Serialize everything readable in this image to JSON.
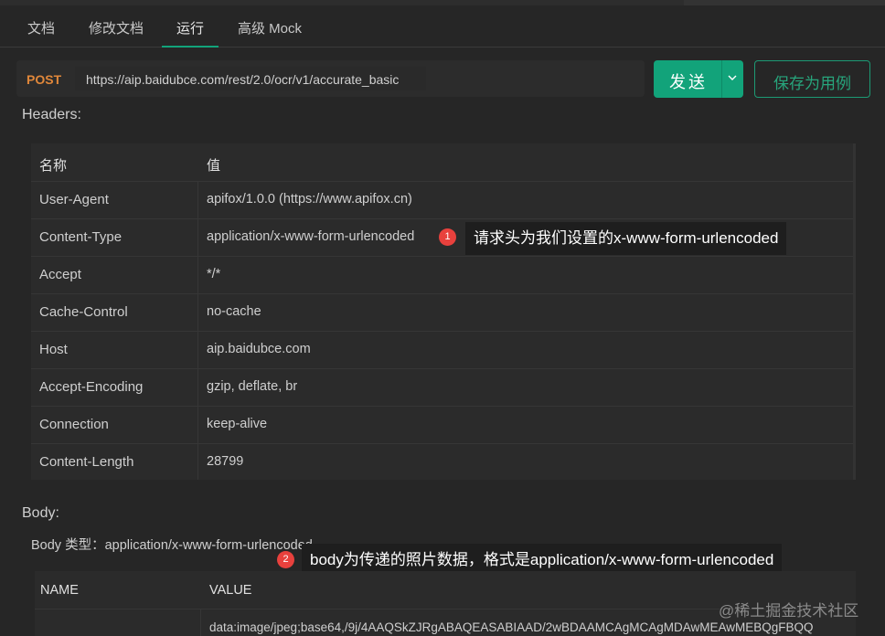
{
  "tabs": [
    {
      "label": "文档"
    },
    {
      "label": "修改文档"
    },
    {
      "label": "运行"
    },
    {
      "label": "高级 Mock"
    }
  ],
  "request": {
    "method": "POST",
    "url": "https://aip.baidubce.com/rest/2.0/ocr/v1/accurate_basic",
    "send_label": "发送",
    "save_label": "保存为用例"
  },
  "headers": {
    "title": "Headers:",
    "col_name": "名称",
    "col_value": "值",
    "rows": [
      {
        "name": "User-Agent",
        "value": "apifox/1.0.0 (https://www.apifox.cn)"
      },
      {
        "name": "Content-Type",
        "value": "application/x-www-form-urlencoded"
      },
      {
        "name": "Accept",
        "value": "*/*"
      },
      {
        "name": "Cache-Control",
        "value": "no-cache"
      },
      {
        "name": "Host",
        "value": "aip.baidubce.com"
      },
      {
        "name": "Accept-Encoding",
        "value": "gzip, deflate, br"
      },
      {
        "name": "Connection",
        "value": "keep-alive"
      },
      {
        "name": "Content-Length",
        "value": "28799"
      }
    ]
  },
  "annotations": [
    {
      "number": "1",
      "text": "请求头为我们设置的x-www-form-urlencoded"
    },
    {
      "number": "2",
      "text": "body为传递的照片数据，格式是application/x-www-form-urlencoded"
    }
  ],
  "body": {
    "title": "Body:",
    "type_line": "Body 类型：application/x-www-form-urlencoded",
    "col_name": "NAME",
    "col_value": "VALUE",
    "value_preview": "data:image/jpeg;base64,/9j/4AAQSkZJRgABAQEASABIAAD/2wBDAAMCAgMCAgMDAwMEAwMEBQgFBQQ"
  },
  "watermark": "@稀土掘金技术社区",
  "colors": {
    "accent": "#12a37a",
    "method": "#e0873a",
    "badge": "#e8413d",
    "background": "#262626"
  }
}
